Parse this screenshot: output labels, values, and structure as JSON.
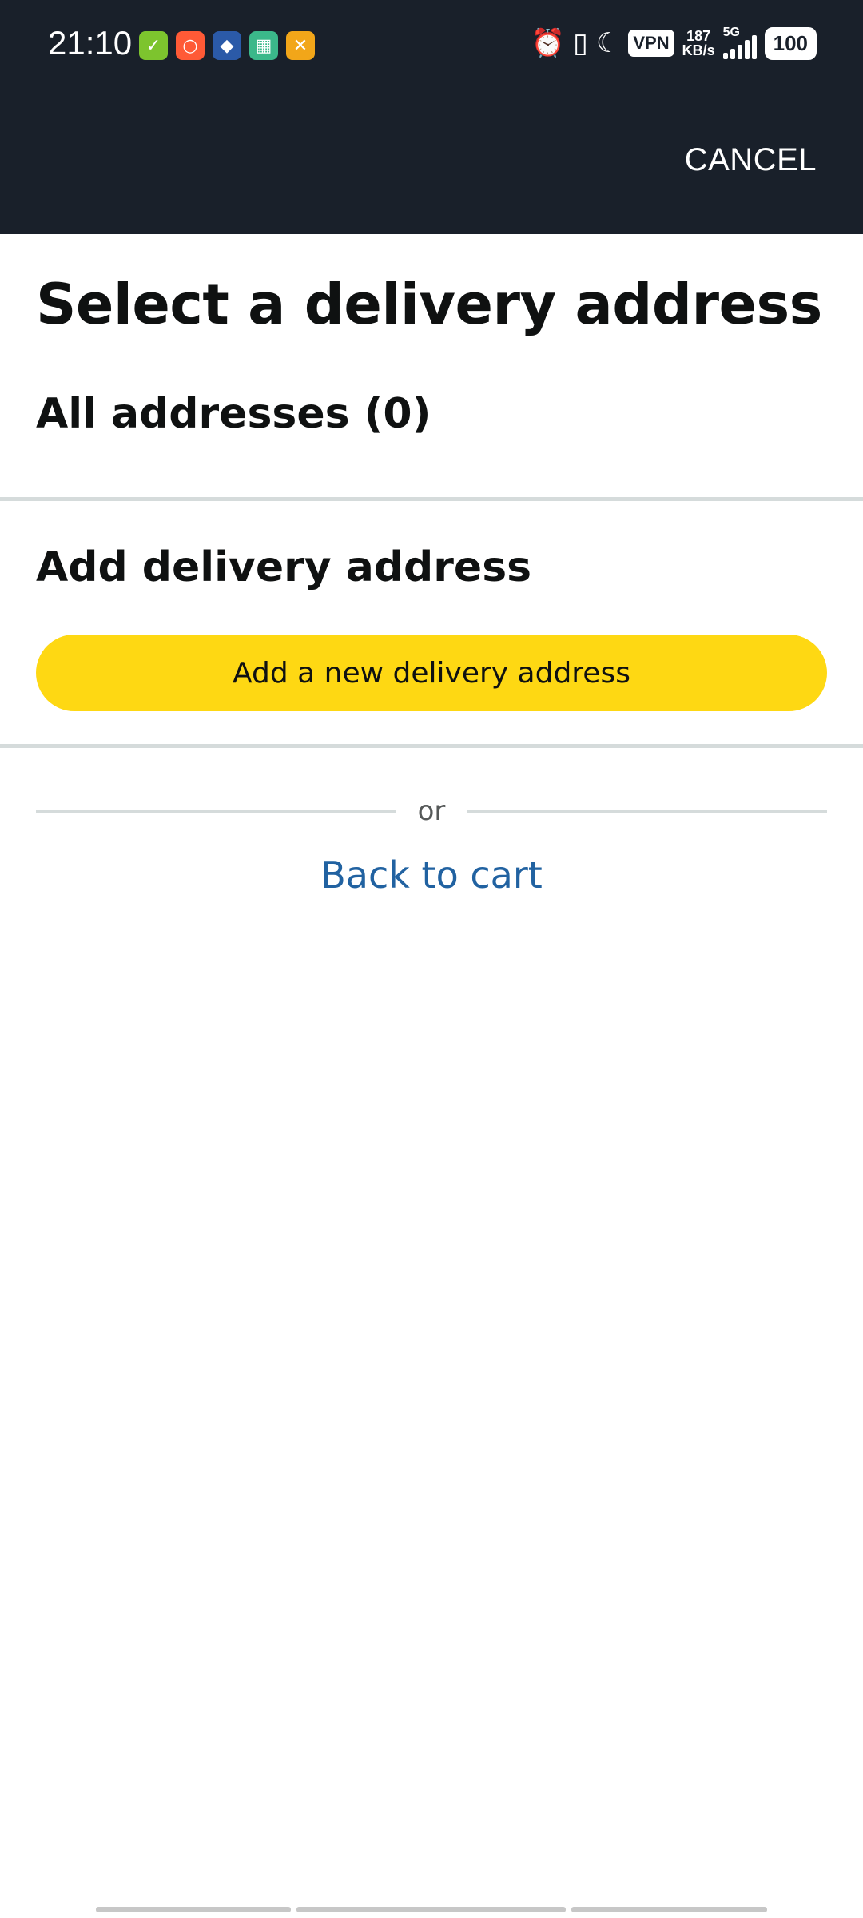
{
  "status_bar": {
    "time": "21:10",
    "notification_icons": [
      {
        "name": "app-checklist-icon",
        "color": "#7dc42e",
        "glyph": "✓"
      },
      {
        "name": "app-ring-icon",
        "color": "#ff5a36",
        "glyph": "○"
      },
      {
        "name": "app-cat-icon",
        "color": "#2b5aa8",
        "glyph": "◆"
      },
      {
        "name": "app-calculator-icon",
        "color": "#3bb88a",
        "glyph": "▦"
      },
      {
        "name": "app-tools-icon",
        "color": "#f2a619",
        "glyph": "✕"
      }
    ],
    "vpn_label": "VPN",
    "speed_value": "187",
    "speed_unit": "KB/s",
    "network_type": "5G",
    "battery_level": "100"
  },
  "header": {
    "cancel_label": "CANCEL"
  },
  "main": {
    "title": "Select a delivery address",
    "all_addresses_label": "All addresses (0)",
    "add_section_heading": "Add delivery address",
    "add_button_label": "Add a new delivery address",
    "or_label": "or",
    "back_link_label": "Back to cart"
  },
  "colors": {
    "header_bg": "#19202a",
    "button_yellow": "#fed813",
    "link_blue": "#2162a1",
    "divider": "#d5dbdb"
  }
}
